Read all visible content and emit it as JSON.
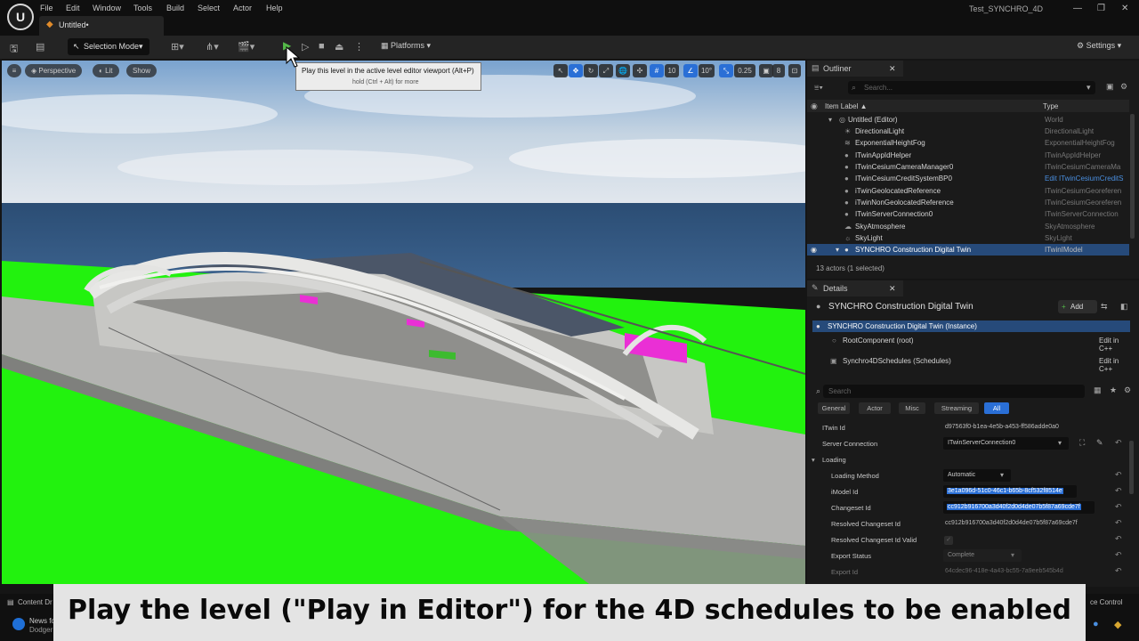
{
  "menu": [
    "File",
    "Edit",
    "Window",
    "Tools",
    "Build",
    "Select",
    "Actor",
    "Help"
  ],
  "doc_tab": "Untitled•",
  "project_name": "Test_SYNCHRO_4D",
  "toolbar": {
    "selection_mode": "Selection Mode",
    "platforms": "Platforms",
    "settings": "Settings"
  },
  "viewport": {
    "perspective": "Perspective",
    "lit": "Lit",
    "show": "Show",
    "grid_snap": "10",
    "rot_snap": "10°",
    "scale_snap": "0.25",
    "cam_speed": "8"
  },
  "tooltip": {
    "main": "Play this level in the active level editor viewport (Alt+P)",
    "sub": "hold (Ctrl + Alt) for more"
  },
  "outliner": {
    "title": "Outliner",
    "search_placeholder": "Search...",
    "col_label": "Item Label ▲",
    "col_type": "Type",
    "rows": [
      {
        "label": "Untitled (Editor)",
        "type": "World"
      },
      {
        "label": "DirectionalLight",
        "type": "DirectionalLight"
      },
      {
        "label": "ExponentialHeightFog",
        "type": "ExponentialHeightFog"
      },
      {
        "label": "ITwinAppIdHelper",
        "type": "ITwinAppIdHelper"
      },
      {
        "label": "ITwinCesiumCameraManager0",
        "type": "ITwinCesiumCameraMa"
      },
      {
        "label": "ITwinCesiumCreditSystemBP0",
        "type": "Edit ITwinCesiumCreditS"
      },
      {
        "label": "iTwinGeolocatedReference",
        "type": "ITwinCesiumGeoreferen"
      },
      {
        "label": "iTwinNonGeolocatedReference",
        "type": "ITwinCesiumGeoreferen"
      },
      {
        "label": "ITwinServerConnection0",
        "type": "ITwinServerConnection"
      },
      {
        "label": "SkyAtmosphere",
        "type": "SkyAtmosphere"
      },
      {
        "label": "SkyLight",
        "type": "SkyLight"
      },
      {
        "label": "SYNCHRO Construction Digital Twin",
        "type": "ITwinIModel"
      }
    ],
    "status": "13 actors (1 selected)"
  },
  "details": {
    "title": "Details",
    "actor_name": "SYNCHRO Construction Digital Twin",
    "add": "Add",
    "instance": "SYNCHRO Construction Digital Twin (Instance)",
    "root_component": "RootComponent (root)",
    "schedules": "Synchro4DSchedules (Schedules)",
    "edit_cpp": "Edit in C++",
    "search_placeholder": "Search",
    "filters": [
      "General",
      "Actor",
      "Misc",
      "Streaming",
      "All"
    ],
    "props": {
      "itwin_id": {
        "name": "ITwin Id",
        "value": "d97563f0-b1ea-4e5b-a453-ff586adde0a0"
      },
      "server_connection": {
        "name": "Server Connection",
        "value": "ITwinServerConnection0"
      },
      "loading": "Loading",
      "loading_method": {
        "name": "Loading Method",
        "value": "Automatic"
      },
      "imodel_id": {
        "name": "iModel Id",
        "value": "3e1a096d-51c0-46c1-b65b-8cf532f8514e"
      },
      "changeset_id": {
        "name": "Changeset Id",
        "value": "cc912b916700a3d40f2d0d4de07b5f87a69cde7f"
      },
      "resolved_changeset_id": {
        "name": "Resolved Changeset Id",
        "value": "cc912b916700a3d40f2d0d4de07b5f87a69cde7f"
      },
      "resolved_changeset_valid": {
        "name": "Resolved Changeset Id Valid",
        "value": "✓"
      },
      "export_status": {
        "name": "Export Status",
        "value": "Complete"
      },
      "export_id": {
        "name": "Export Id",
        "value": "64cdec96-418e-4a43-bc55-7a9eeb545b4d"
      }
    }
  },
  "bottom": {
    "content_drawer": "Content Dr",
    "news": "News fo",
    "dodgers": "Dodger",
    "source_control": "ce Control"
  },
  "caption": "Play the level (\"Play in Editor\") for the 4D schedules to be enabled",
  "colors": {
    "accent_blue": "#2a6fd6",
    "selected_row": "#264a7a",
    "play_green": "#54b948",
    "ground_green": "#22f20e"
  }
}
